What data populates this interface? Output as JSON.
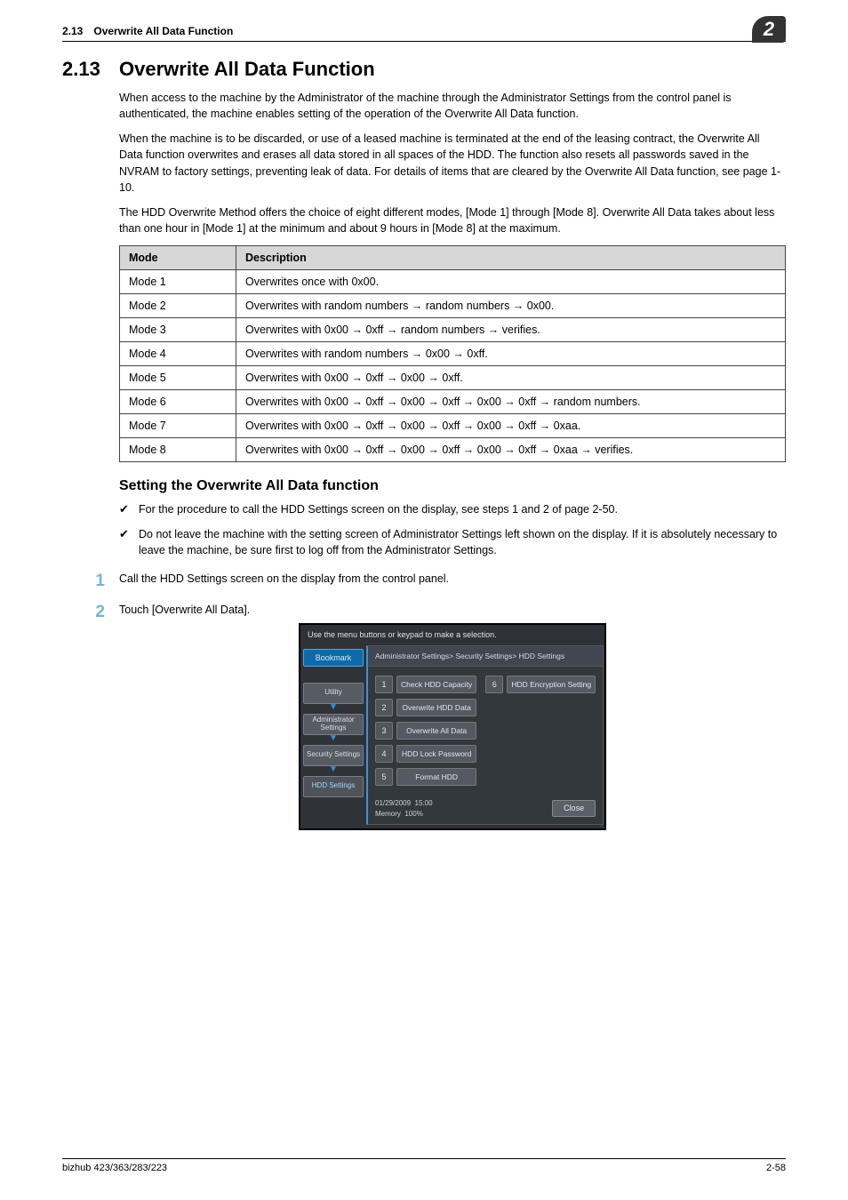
{
  "header": {
    "running": "2.13 Overwrite All Data Function",
    "chapter_badge": "2"
  },
  "section": {
    "number": "2.13",
    "title": "Overwrite All Data Function"
  },
  "paragraphs": {
    "p1": "When access to the machine by the Administrator of the machine through the Administrator Settings from the control panel is authenticated, the machine enables setting of the operation of the Overwrite All Data function.",
    "p2": "When the machine is to be discarded, or use of a leased machine is terminated at the end of the leasing contract, the Overwrite All Data function overwrites and erases all data stored in all spaces of the HDD. The function also resets all passwords saved in the NVRAM to factory settings, preventing leak of data. For details of items that are cleared by the Overwrite All Data function, see page 1-10.",
    "p3": "The HDD Overwrite Method offers the choice of eight different modes, [Mode 1] through [Mode 8]. Overwrite All Data takes about less than one hour in [Mode 1] at the minimum and about 9 hours in [Mode 8] at the maximum."
  },
  "table": {
    "head_mode": "Mode",
    "head_desc": "Description",
    "rows": [
      {
        "mode": "Mode 1",
        "desc": "Overwrites once with 0x00."
      },
      {
        "mode": "Mode 2",
        "desc": "Overwrites with random numbers → random numbers → 0x00."
      },
      {
        "mode": "Mode 3",
        "desc": "Overwrites with 0x00 → 0xff → random numbers → verifies."
      },
      {
        "mode": "Mode 4",
        "desc": "Overwrites with random numbers → 0x00 → 0xff."
      },
      {
        "mode": "Mode 5",
        "desc": "Overwrites with 0x00 → 0xff → 0x00 → 0xff."
      },
      {
        "mode": "Mode 6",
        "desc": "Overwrites with 0x00 → 0xff → 0x00 → 0xff → 0x00 → 0xff → random numbers."
      },
      {
        "mode": "Mode 7",
        "desc": "Overwrites with 0x00 → 0xff → 0x00 → 0xff → 0x00 → 0xff → 0xaa."
      },
      {
        "mode": "Mode 8",
        "desc": "Overwrites with 0x00 → 0xff → 0x00 → 0xff → 0x00 → 0xff → 0xaa → verifies."
      }
    ]
  },
  "subhead": "Setting the Overwrite All Data function",
  "checks": [
    "For the procedure to call the HDD Settings screen on the display, see steps 1 and 2 of page 2-50.",
    "Do not leave the machine with the setting screen of Administrator Settings left shown on the display. If it is absolutely necessary to leave the machine, be sure first to log off from the Administrator Settings."
  ],
  "steps": [
    {
      "n": "1",
      "text": "Call the HDD Settings screen on the display from the control panel."
    },
    {
      "n": "2",
      "text": "Touch [Overwrite All Data]."
    }
  ],
  "ui": {
    "topmsg": "Use the menu buttons or keypad to make a selection.",
    "bookmark": "Bookmark",
    "side": {
      "utility": "Utility",
      "admin": "Administrator Settings",
      "security": "Security Settings",
      "hdd": "HDD Settings"
    },
    "breadcrumb": "Administrator Settings> Security Settings> HDD Settings",
    "items": [
      {
        "n": "1",
        "label": "Check HDD Capacity"
      },
      {
        "n": "2",
        "label": "Overwrite HDD Data"
      },
      {
        "n": "3",
        "label": "Overwrite All Data"
      },
      {
        "n": "4",
        "label": "HDD Lock Password"
      },
      {
        "n": "5",
        "label": "Format HDD"
      },
      {
        "n": "6",
        "label": "HDD Encryption Setting"
      }
    ],
    "status_date": "01/29/2009",
    "status_time": "15:00",
    "status_mem_label": "Memory",
    "status_mem_value": "100%",
    "close": "Close"
  },
  "footer": {
    "left": "bizhub 423/363/283/223",
    "right": "2-58"
  }
}
